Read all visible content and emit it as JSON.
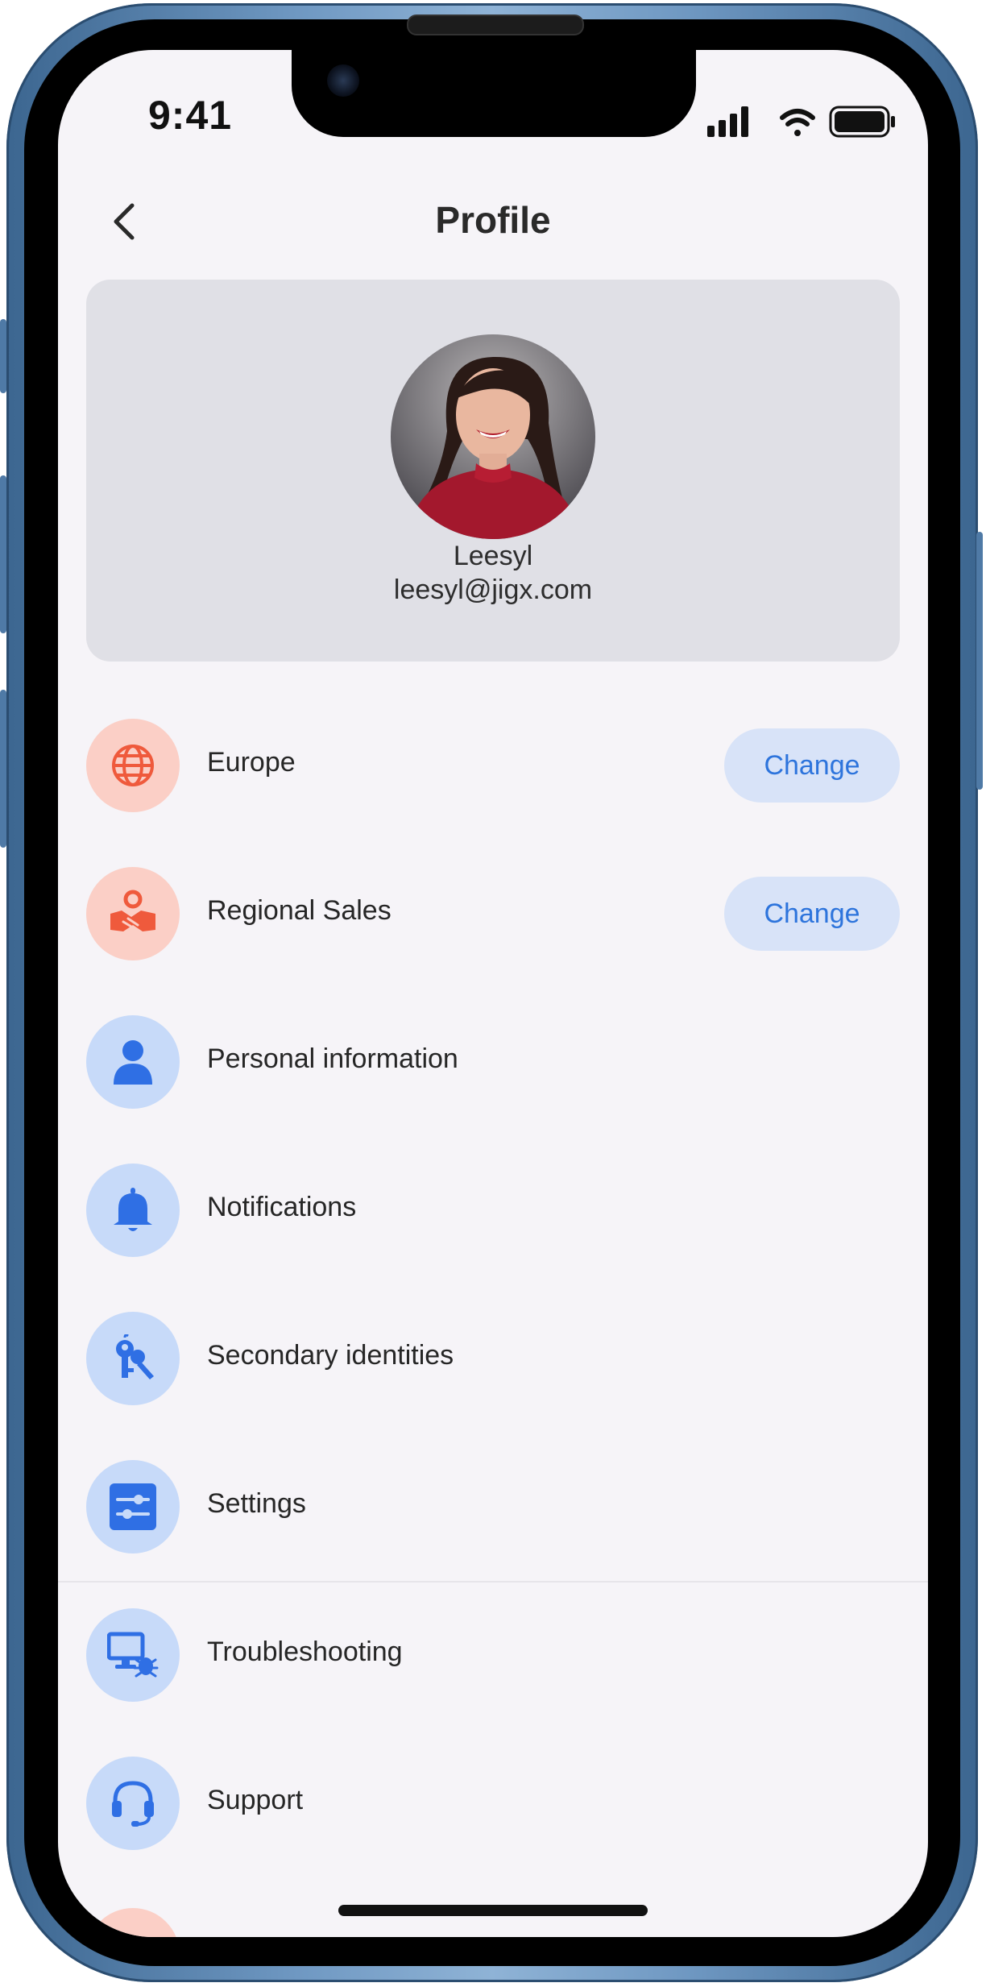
{
  "status_bar": {
    "time": "9:41"
  },
  "nav": {
    "title": "Profile"
  },
  "profile": {
    "name": "Leesyl",
    "email": "leesyl@jigx.com"
  },
  "menu": [
    {
      "label": "Europe",
      "icon": "globe-icon",
      "action": "Change"
    },
    {
      "label": "Regional Sales",
      "icon": "handshake-icon",
      "action": "Change"
    },
    {
      "label": "Personal information",
      "icon": "person-icon"
    },
    {
      "label": "Notifications",
      "icon": "bell-icon"
    },
    {
      "label": "Secondary identities",
      "icon": "keys-icon"
    },
    {
      "label": "Settings",
      "icon": "sliders-icon"
    },
    {
      "label": "Troubleshooting",
      "icon": "monitor-bug-icon"
    },
    {
      "label": "Support",
      "icon": "headset-icon"
    }
  ],
  "colors": {
    "accent_blue": "#2d74dc",
    "icon_blue": "#2f6fe4",
    "icon_red": "#ef5a3c",
    "circle_blue": "#c7daf9",
    "circle_red": "#fbcfc6",
    "button_bg": "#d8e3f8",
    "screen_bg": "#f6f4f8"
  }
}
